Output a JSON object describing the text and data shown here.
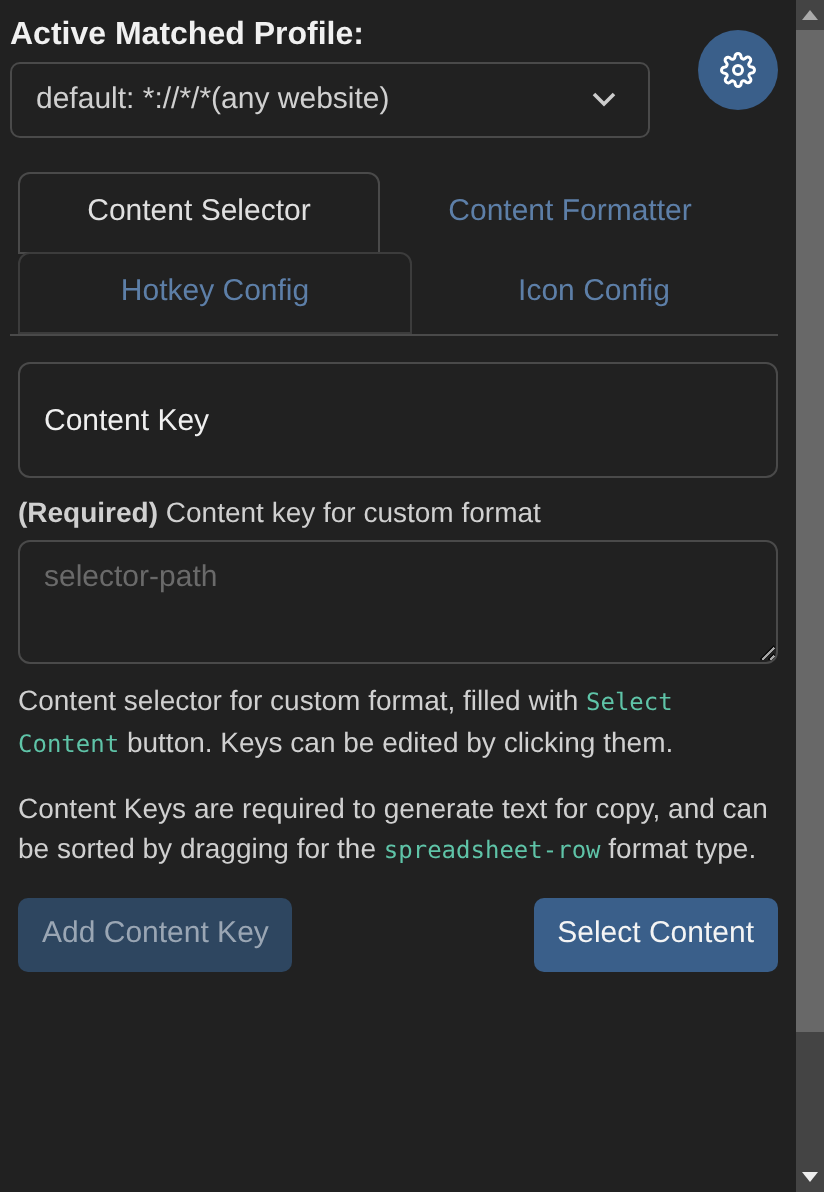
{
  "profile": {
    "label": "Active Matched Profile:",
    "value": "default: *://*/*(any website)"
  },
  "tabs": [
    {
      "label": "Content Selector",
      "selected": true,
      "hovered": false
    },
    {
      "label": "Content Formatter",
      "selected": false,
      "hovered": false
    },
    {
      "label": "Hotkey Config",
      "selected": false,
      "hovered": true
    },
    {
      "label": "Icon Config",
      "selected": false,
      "hovered": false
    }
  ],
  "content_key": {
    "value": "Content Key"
  },
  "selector_label": "**(Required)** Content key for custom format",
  "selector_field": {
    "placeholder": "selector-path"
  },
  "help": [
    [
      {
        "kind": "text",
        "text": "Content selector for custom format, filled with "
      },
      {
        "kind": "code",
        "text": "Select Content"
      },
      {
        "kind": "text",
        "text": " button. Keys can be edited by clicking them."
      }
    ],
    [
      {
        "kind": "text",
        "text": "Content Keys are required to generate text for copy, and can be sorted by dragging for the "
      },
      {
        "kind": "code",
        "text": "spreadsheet-row"
      },
      {
        "kind": "text",
        "text": " format type."
      }
    ]
  ],
  "buttons": [
    {
      "label": "Add Content Key",
      "disabled": true
    },
    {
      "label": "Select Content",
      "disabled": false
    }
  ]
}
